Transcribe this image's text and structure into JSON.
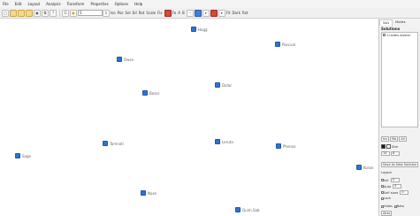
{
  "menu": [
    "File",
    "Edit",
    "Layout",
    "Analysis",
    "Transform",
    "Properties",
    "Options",
    "Help"
  ],
  "toolbar": {
    "zoom_value": "5",
    "labels": [
      "Iso",
      "Pos",
      "Sel",
      "Ed",
      "Rot",
      "Scale",
      "Fix",
      "Fo",
      "A",
      "B",
      "Fit",
      "Dark",
      "Rst"
    ],
    "highlight_color": "#f2cf54",
    "accent_color": "#2f73d4"
  },
  "nodes": [
    {
      "label": "Hagg",
      "id": "hagg"
    },
    {
      "label": "Pascual",
      "id": "pascual"
    },
    {
      "label": "Owse",
      "id": "owse"
    },
    {
      "label": "Dolac",
      "id": "dolac"
    },
    {
      "label": "Bosar",
      "id": "bosar"
    },
    {
      "label": "Tomnati",
      "id": "tomnati"
    },
    {
      "label": "Leruta",
      "id": "leruta"
    },
    {
      "label": "Phenos",
      "id": "phenos"
    },
    {
      "label": "Sage",
      "id": "sage"
    },
    {
      "label": "Koran",
      "id": "koran"
    },
    {
      "label": "Nose",
      "id": "nose"
    },
    {
      "label": "Quim.Sab",
      "id": "quimsab"
    }
  ],
  "panel": {
    "tabs": [
      "Sols",
      "Modes"
    ],
    "solutions_title": "Solutions",
    "solution_row": "1.nodes.4/solsn",
    "controls_row1": [
      "Ins",
      "Mo",
      "All"
    ],
    "size_label": "Size",
    "field_a": "14",
    "field_b": "8",
    "save_button": "Save As New Solution",
    "layout_label": "Layout",
    "option_labels": [
      "Init",
      "Auto",
      "Self sizes",
      "Lock"
    ],
    "option_values": [
      "0",
      "0",
      "0"
    ],
    "footer_checks": [
      "Hides",
      "Beta"
    ],
    "footer_tab": "Alias"
  }
}
